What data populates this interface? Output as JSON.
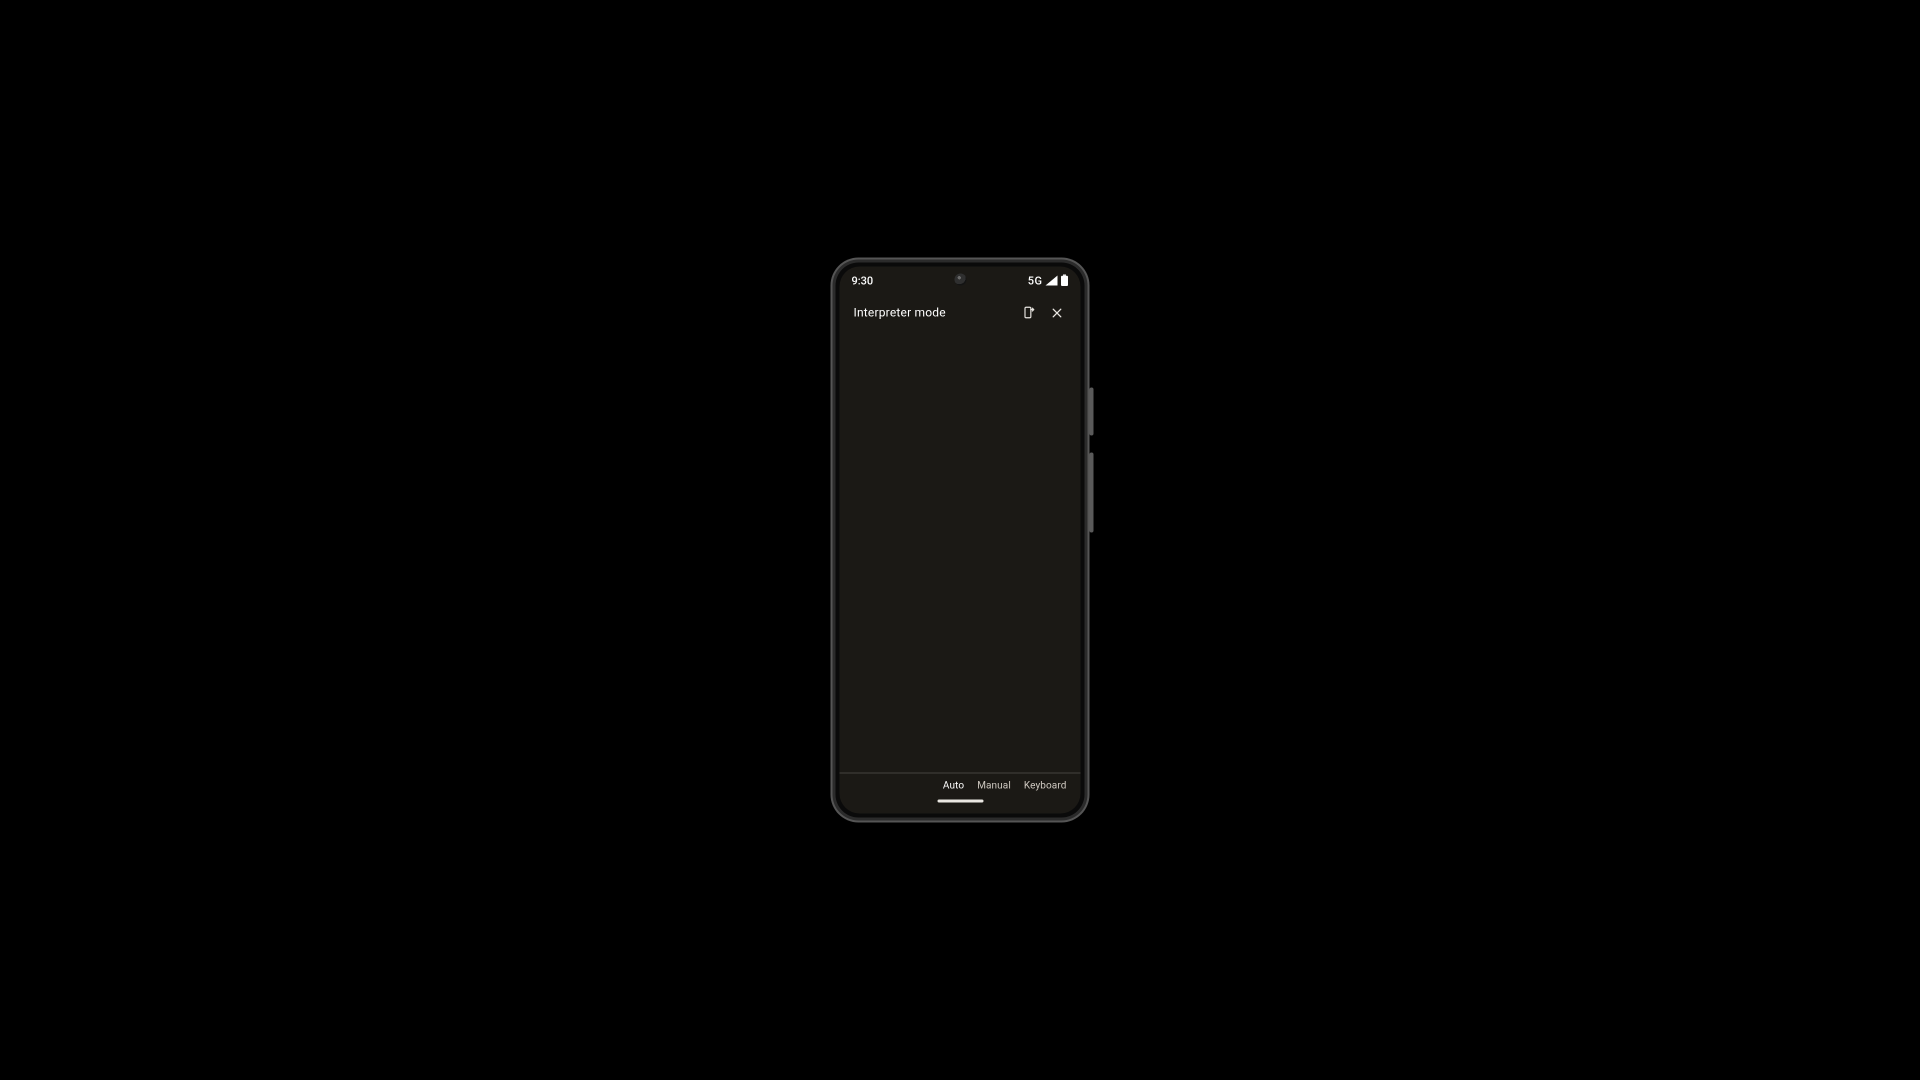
{
  "status_bar": {
    "time": "9:30",
    "network_label": "5G"
  },
  "header": {
    "title": "Interpreter mode",
    "icons": {
      "send_to_device": "send-to-device-icon",
      "close": "close-icon"
    }
  },
  "mode_bar": {
    "tabs": [
      {
        "label": "Auto",
        "active": true
      },
      {
        "label": "Manual",
        "active": false
      },
      {
        "label": "Keyboard",
        "active": false
      }
    ]
  }
}
